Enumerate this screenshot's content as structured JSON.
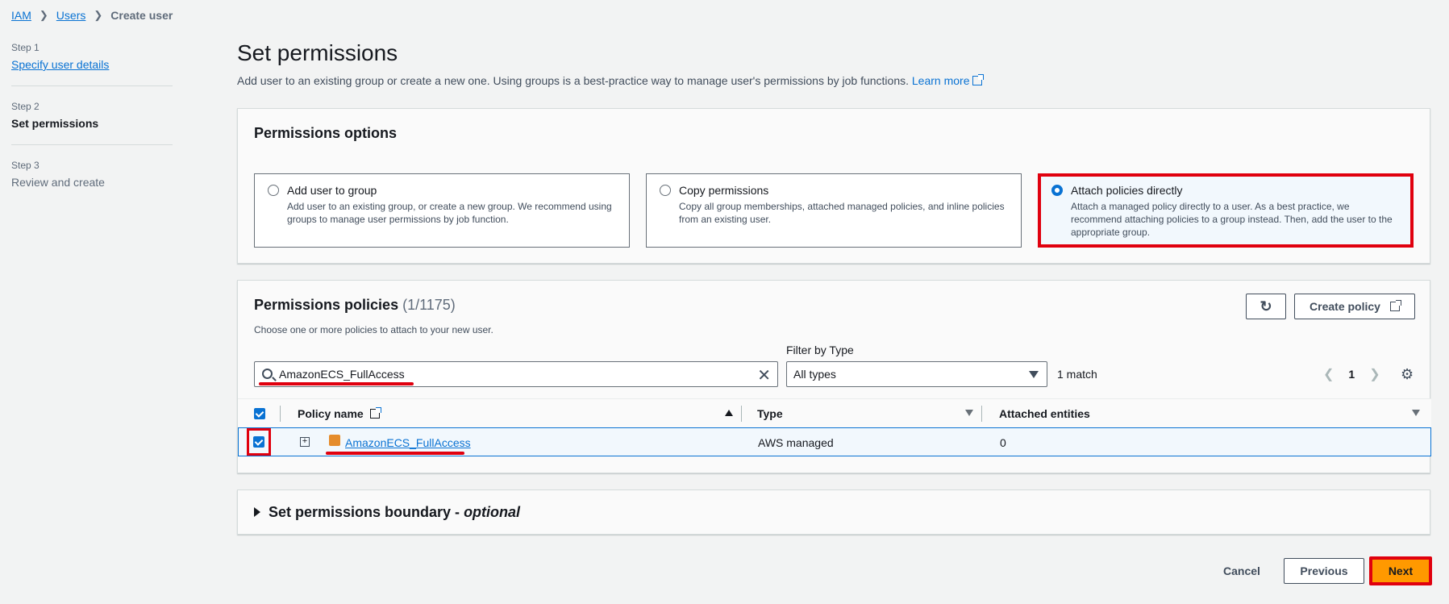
{
  "breadcrumb": {
    "iam": "IAM",
    "users": "Users",
    "current": "Create user"
  },
  "steps": [
    {
      "num": "Step 1",
      "title": "Specify user details"
    },
    {
      "num": "Step 2",
      "title": "Set permissions"
    },
    {
      "num": "Step 3",
      "title": "Review and create"
    }
  ],
  "page": {
    "title": "Set permissions",
    "description": "Add user to an existing group or create a new one. Using groups is a best-practice way to manage user's permissions by job functions.",
    "learn_more": "Learn more"
  },
  "options": {
    "title": "Permissions options",
    "items": [
      {
        "title": "Add user to group",
        "desc": "Add user to an existing group, or create a new group. We recommend using groups to manage user permissions by job function.",
        "selected": false
      },
      {
        "title": "Copy permissions",
        "desc": "Copy all group memberships, attached managed policies, and inline policies from an existing user.",
        "selected": false
      },
      {
        "title": "Attach policies directly",
        "desc": "Attach a managed policy directly to a user. As a best practice, we recommend attaching policies to a group instead. Then, add the user to the appropriate group.",
        "selected": true
      }
    ]
  },
  "policies": {
    "title": "Permissions policies",
    "count": "(1/1175)",
    "desc": "Choose one or more policies to attach to your new user.",
    "create_label": "Create policy",
    "filter_label": "Filter by Type",
    "search_value": "AmazonECS_FullAccess",
    "filter_value": "All types",
    "match": "1 match",
    "page": "1",
    "columns": {
      "name": "Policy name",
      "type": "Type",
      "entities": "Attached entities"
    },
    "row": {
      "name": "AmazonECS_FullAccess",
      "type": "AWS managed",
      "entities": "0"
    }
  },
  "boundary": {
    "label": "Set permissions boundary - ",
    "optional": "optional"
  },
  "footer": {
    "cancel": "Cancel",
    "previous": "Previous",
    "next": "Next"
  },
  "colors": {
    "accent": "#0972d3",
    "primary_button": "#ff9900",
    "highlight": "#e0000e"
  }
}
